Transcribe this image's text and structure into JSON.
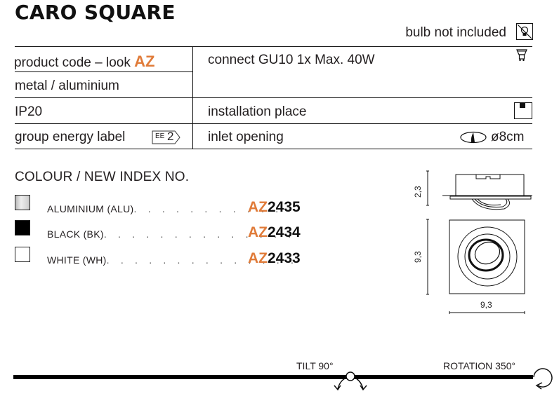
{
  "title": "CARO SQUARE",
  "bulb_note": "bulb not included",
  "specs": {
    "left": [
      {
        "text": "product code – look ",
        "highlight": "AZ"
      },
      {
        "text": "metal / aluminium"
      },
      {
        "text": "IP20"
      },
      {
        "text": "group energy label",
        "badge_prefix": "EE",
        "badge_value": "2"
      }
    ],
    "right": [
      {
        "text": "connect GU10 1x Max. 40W",
        "icon": "gu10-bulb-icon"
      },
      {
        "text": "installation place",
        "icon": "ceiling-installation-icon"
      },
      {
        "text": "inlet opening",
        "value": "ø8cm",
        "icon": "inlet-opening-icon"
      }
    ]
  },
  "colours": {
    "heading": "COLOUR / NEW INDEX NO.",
    "items": [
      {
        "label": "ALUMINIUM (ALU)",
        "dots": ". . . . . . . . . . .",
        "prefix": "AZ",
        "number": "2435",
        "swatch": "#d9d9d9"
      },
      {
        "label": "BLACK (BK)",
        "dots": ". . . . . . . . . . . . . .",
        "prefix": "AZ",
        "number": "2434",
        "swatch": "#000000"
      },
      {
        "label": "WHITE (WH)",
        "dots": ". . . . . . . . . . . . . .",
        "prefix": "AZ",
        "number": "2433",
        "swatch": "#ffffff"
      }
    ]
  },
  "dimensions": {
    "height": "2,3",
    "depth": "9,3",
    "width": "9,3"
  },
  "features": {
    "tilt": "TILT 90°",
    "rotation": "ROTATION 350°"
  },
  "accent_color": "#e07b39"
}
